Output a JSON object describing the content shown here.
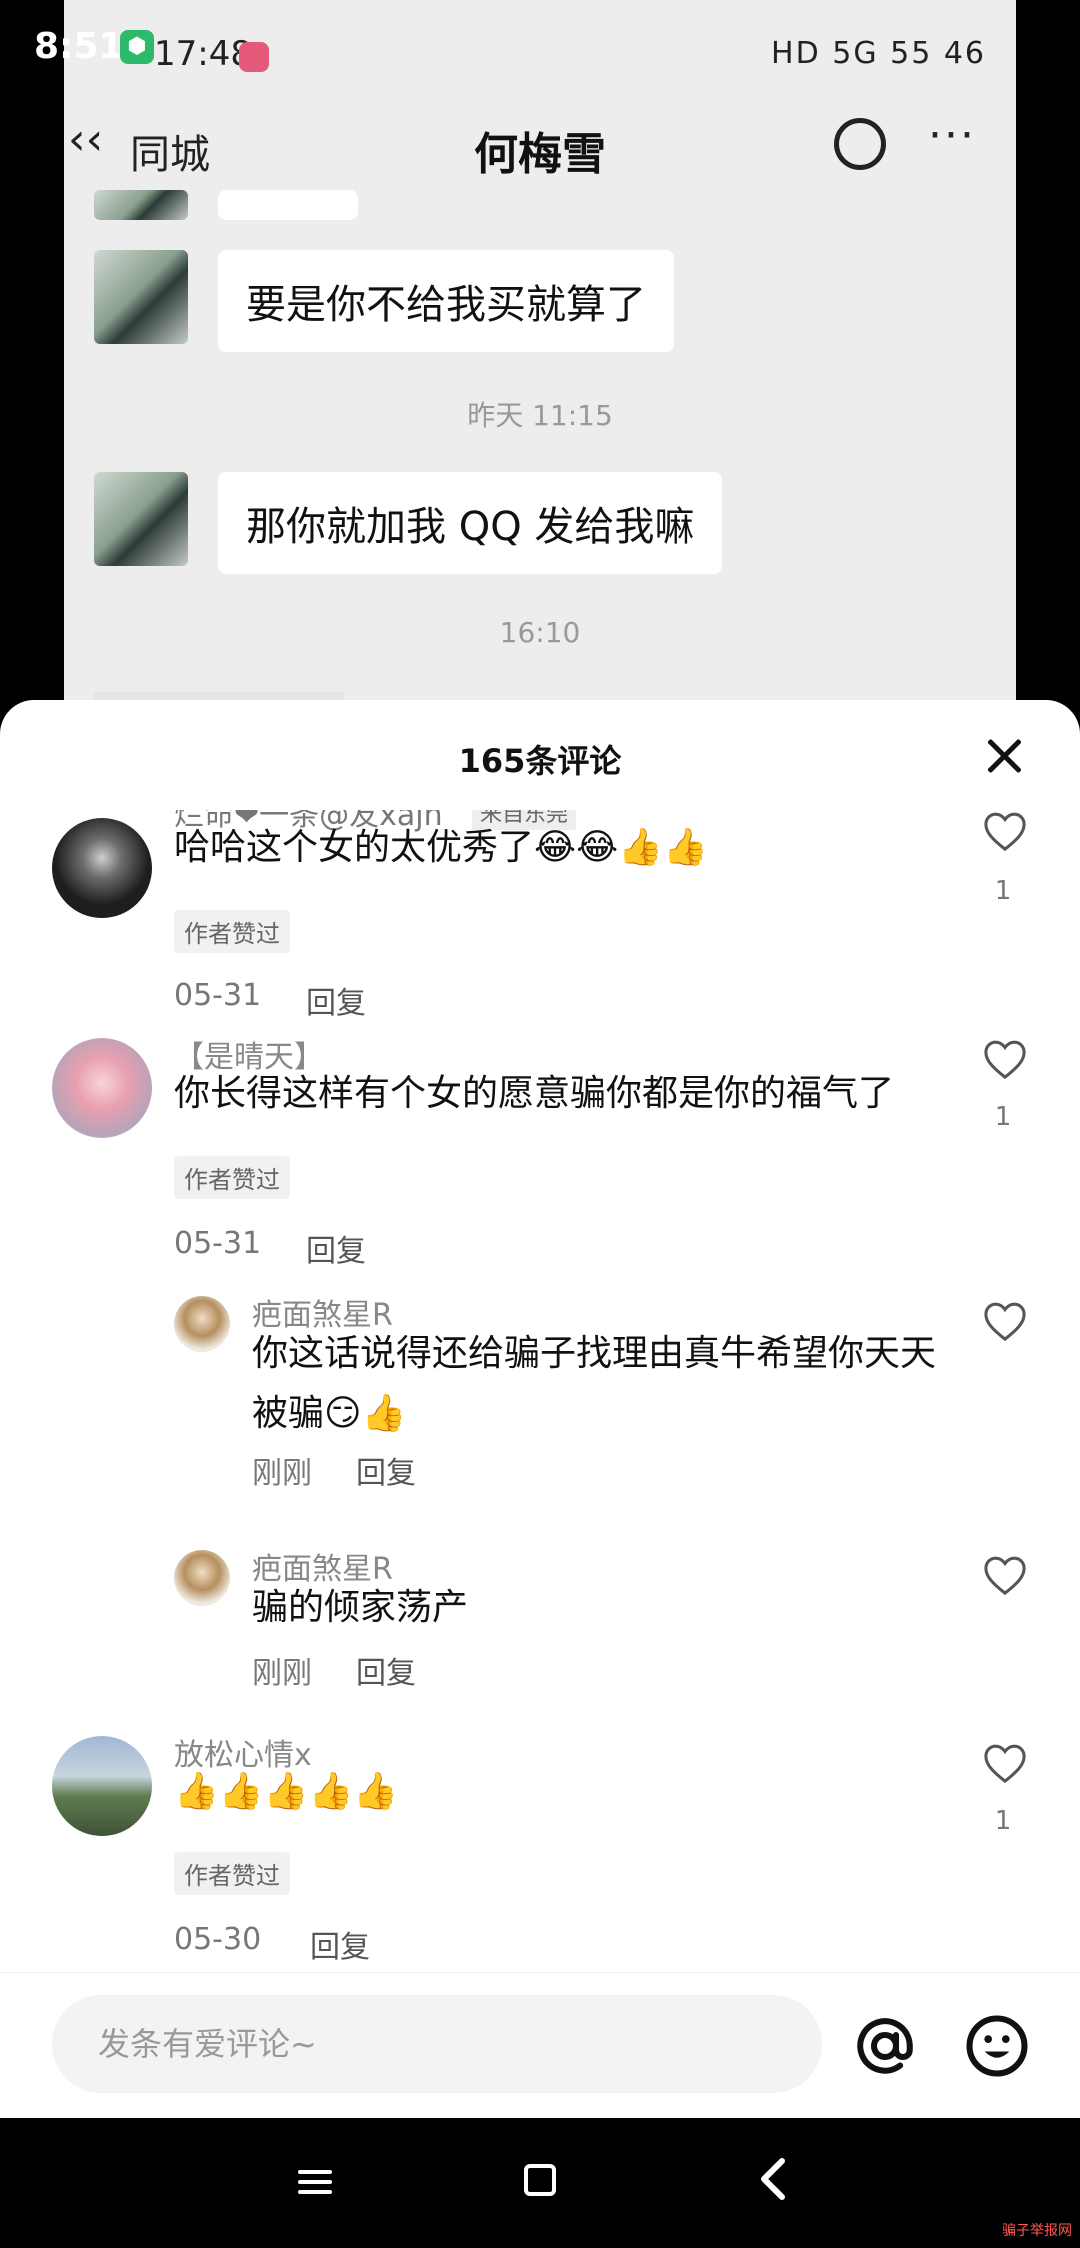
{
  "outer_status": {
    "time": "8:51"
  },
  "video": {
    "status_time": "17:48",
    "status_right": "HD 5G 55 46",
    "nav": {
      "back_label": "同城",
      "title": "何梅雪"
    },
    "messages": [
      {
        "text": "要是你不给我买就算了"
      },
      {
        "text": "那你就加我 QQ 发给我嘛"
      }
    ],
    "timestamps": [
      "昨天 11:15",
      "16:10"
    ]
  },
  "sheet": {
    "title": "165条评论",
    "comments": [
      {
        "author": "烂命❤一条@友xajn",
        "badge": "来自东莞",
        "text": "哈哈这个女的太优秀了😂😂👍👍",
        "tag": "作者赞过",
        "date": "05-31",
        "reply": "回复",
        "likes": "1"
      },
      {
        "author": "【是晴天】",
        "text": "你长得这样有个女的愿意骗你都是你的福气了",
        "tag": "作者赞过",
        "date": "05-31",
        "reply": "回复",
        "likes": "1"
      },
      {
        "author": "疤面煞星R",
        "text": "你这话说得还给骗子找理由真牛希望你天天被骗😏👍",
        "date": "刚刚",
        "reply": "回复"
      },
      {
        "author": "疤面煞星R",
        "text": "骗的倾家荡产",
        "date": "刚刚",
        "reply": "回复"
      },
      {
        "author": "放松心情x",
        "text": "👍👍👍👍👍",
        "tag": "作者赞过",
        "date": "05-30",
        "reply": "回复",
        "likes": "1"
      }
    ],
    "input_placeholder": "发条有爱评论~"
  },
  "watermark": "骗子举报网"
}
